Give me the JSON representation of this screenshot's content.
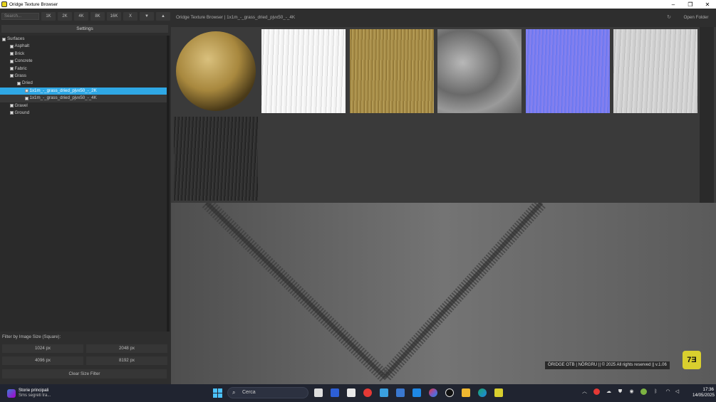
{
  "window": {
    "title": "Oridge Texture Browser",
    "controls": [
      "–",
      "❐",
      "✕"
    ]
  },
  "toolbar": {
    "search_placeholder": "Search...",
    "resolution_buttons": [
      "1K",
      "2K",
      "4K",
      "8K",
      "16K",
      "X",
      "▼",
      "▲"
    ],
    "settings_label": "Settings"
  },
  "tree": [
    {
      "label": "Surfaces",
      "level": 0,
      "state": "expanded"
    },
    {
      "label": "Asphalt",
      "level": 1,
      "state": "collapsed"
    },
    {
      "label": "Brick",
      "level": 1,
      "state": "collapsed"
    },
    {
      "label": "Concrete",
      "level": 1,
      "state": "collapsed"
    },
    {
      "label": "Fabric",
      "level": 1,
      "state": "collapsed"
    },
    {
      "label": "Grass",
      "level": 1,
      "state": "expanded"
    },
    {
      "label": "Dried",
      "level": 2,
      "state": "expanded"
    },
    {
      "label": "1x1m_-_grass_dried_pjvx50_-_2K",
      "level": 3,
      "state": "leaf",
      "selected": true
    },
    {
      "label": "1x1m_-_grass_dried_pjvx50_-_4K",
      "level": 3,
      "state": "leaf"
    },
    {
      "label": "Gravel",
      "level": 1,
      "state": "collapsed"
    },
    {
      "label": "Ground",
      "level": 1,
      "state": "collapsed"
    }
  ],
  "filter": {
    "title": "Filter by Image Size (Square):",
    "sizes": [
      "1024 px",
      "2048 px",
      "4096 px",
      "8192 px"
    ],
    "clear_label": "Clear Size Filter"
  },
  "header": {
    "breadcrumb": "Oridge Texture Browser | 1x1m_-_grass_dried_pjvx50_-_4K",
    "refresh_icon": "↻",
    "open_folder_label": "Open Folder"
  },
  "thumbnails": [
    {
      "name": "sphere-preview",
      "kind": "sphere",
      "color": "#b89a54"
    },
    {
      "name": "ao-map",
      "kind": "flat",
      "color": "#e8e8e8"
    },
    {
      "name": "albedo-map",
      "kind": "flat",
      "color": "#9b8240"
    },
    {
      "name": "displacement-map",
      "kind": "flat",
      "color": "#8a8a8a"
    },
    {
      "name": "normal-map",
      "kind": "flat",
      "color": "#7b7ef0"
    },
    {
      "name": "specular-map",
      "kind": "flat",
      "color": "#c8c8c8"
    },
    {
      "name": "roughness-map",
      "kind": "flat",
      "color": "#2c2c2c"
    }
  ],
  "footer": {
    "credits": "ÖRIDGE OTB | NÖRGRU || © 2025 All rights reserved || v.1.06",
    "logo_text": "7Ǝ"
  },
  "taskbar": {
    "news_title": "Storie principali",
    "news_subtitle": "Sms segreti tra...",
    "search_label": "Cerca",
    "time": "17:36",
    "date": "14/05/2025"
  }
}
